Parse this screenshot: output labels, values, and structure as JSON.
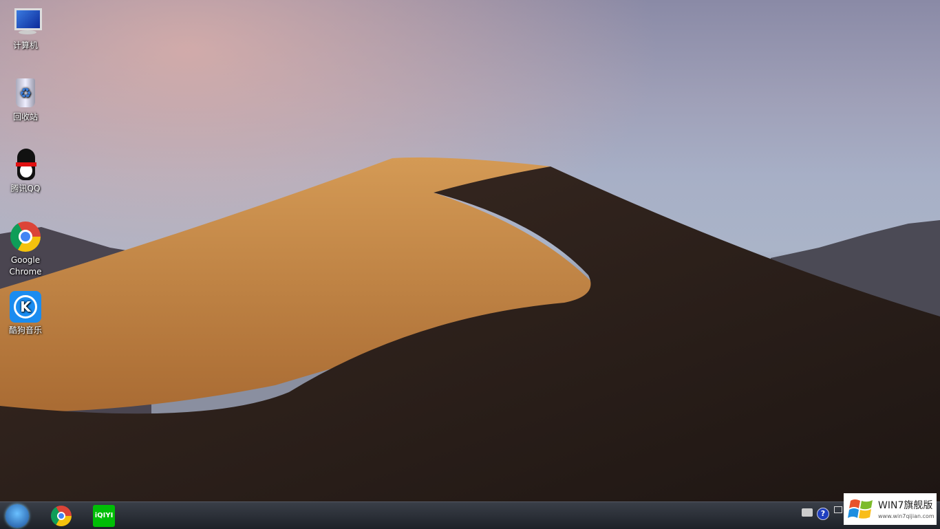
{
  "desktop": {
    "icons": [
      {
        "label": "计算机",
        "icon": "computer-icon"
      },
      {
        "label": "回收站",
        "icon": "recycle-bin-icon"
      },
      {
        "label": "腾讯QQ",
        "icon": "qq-penguin-icon"
      },
      {
        "label": "Google Chrome",
        "icon": "chrome-icon"
      },
      {
        "label": "酷狗音乐",
        "icon": "kugou-icon"
      }
    ]
  },
  "taskbar": {
    "pinned": [
      "chrome-icon",
      "iqiyi-icon"
    ],
    "iqiyi_text": "iQIYI",
    "tray": [
      "keyboard-icon",
      "help-icon",
      "show-windows-icon"
    ]
  },
  "watermark": {
    "title": "WIN7旗舰版",
    "url": "www.win7qijian.com"
  },
  "colors": {
    "taskbar": "#1d2128",
    "sand": "#c98f4a"
  }
}
